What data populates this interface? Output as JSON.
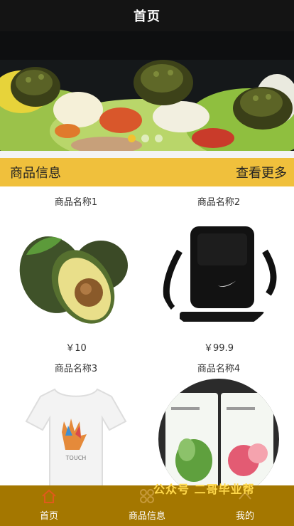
{
  "header": {
    "title": "首页"
  },
  "banner": {
    "slides": 3,
    "active_slide": 1
  },
  "section": {
    "title": "商品信息",
    "more_label": "查看更多"
  },
  "products": [
    {
      "name": "商品名称1",
      "price": "￥10",
      "image": "avocado"
    },
    {
      "name": "商品名称2",
      "price": "￥99.9",
      "image": "black-shoulder-bag"
    },
    {
      "name": "商品名称3",
      "price": "",
      "image": "white-tshirt"
    },
    {
      "name": "商品名称4",
      "price": "",
      "image": "face-mask-packs"
    }
  ],
  "tabbar": {
    "items": [
      {
        "label": "首页",
        "icon": "home-icon",
        "active": true
      },
      {
        "label": "商品信息",
        "icon": "grid-icon",
        "active": false
      },
      {
        "label": "我的",
        "icon": "user-icon",
        "active": false
      }
    ]
  },
  "watermark": {
    "text": "公众号 二哥毕业帮"
  },
  "colors": {
    "header": "#141414",
    "accent": "#f0c03c",
    "tabbar": "#a47700",
    "active_tab_icon": "#e05a1c"
  }
}
